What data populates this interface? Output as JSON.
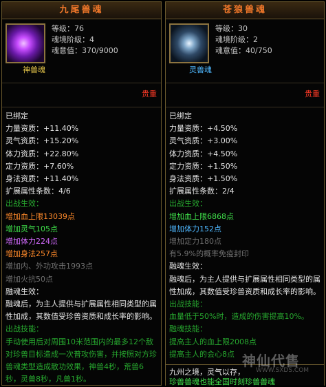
{
  "left": {
    "title": "九尾兽魂",
    "level": "等级：76",
    "soul_stage": "魂境阶级：4",
    "soul_value": "魂意值：370/9000",
    "kind": "神兽魂",
    "rarity": "贵重",
    "lines": [
      {
        "t": "已绑定",
        "c": "w"
      },
      {
        "t": "力量资质：+11.40%",
        "c": "w"
      },
      {
        "t": "灵气资质：+15.20%",
        "c": "w"
      },
      {
        "t": "体力资质：+22.80%",
        "c": "w"
      },
      {
        "t": "定力资质：+7.60%",
        "c": "w"
      },
      {
        "t": "身法资质：+11.40%",
        "c": "w"
      },
      {
        "t": "扩展属性条数：4/6",
        "c": "w"
      },
      {
        "t": "出战生效：",
        "c": "dkgreen"
      },
      {
        "t": "增加血上限13039点",
        "c": "orange"
      },
      {
        "t": "增加灵气105点",
        "c": "green"
      },
      {
        "t": "增加体力224点",
        "c": "purple"
      },
      {
        "t": "增加身法257点",
        "c": "orange"
      },
      {
        "t": "增加内、外功攻击1993点",
        "c": "gray"
      },
      {
        "t": "增加火抗50点",
        "c": "gray"
      },
      {
        "t": "融魂生效：",
        "c": "w"
      },
      {
        "t": "融魂后，为主人提供与扩展属性相同类型的属性加成，其数值受珍兽资质和成长率的影响。",
        "c": "w",
        "wrap": true
      },
      {
        "t": "出战技能：",
        "c": "dkgreen"
      },
      {
        "t": "手动使用后对周围10米范围内的最多12个敌对珍兽目标造成一次普攻伤害，并按照对方珍兽魂类型造成散功效果，神兽4秒，荒兽6秒，灵兽8秒，凡兽1秒。",
        "c": "dkgreen",
        "wrap": true
      }
    ]
  },
  "right": {
    "title": "苍狼兽魂",
    "level": "等级：30",
    "soul_stage": "魂境阶级：2",
    "soul_value": "魂意值：40/750",
    "kind": "灵兽魂",
    "rarity": "贵重",
    "lines": [
      {
        "t": "已绑定",
        "c": "w"
      },
      {
        "t": "力量资质：+4.50%",
        "c": "w"
      },
      {
        "t": "灵气资质：+3.00%",
        "c": "w"
      },
      {
        "t": "体力资质：+4.50%",
        "c": "w"
      },
      {
        "t": "定力资质：+1.50%",
        "c": "w"
      },
      {
        "t": "身法资质：+1.50%",
        "c": "w"
      },
      {
        "t": "扩展属性条数：2/4",
        "c": "w"
      },
      {
        "t": "出战生效：",
        "c": "dkgreen"
      },
      {
        "t": "增加血上限6868点",
        "c": "green"
      },
      {
        "t": "增加体力152点",
        "c": "blue"
      },
      {
        "t": "增加定力180点",
        "c": "gray"
      },
      {
        "t": "有5.9%的概率免疫封印",
        "c": "gray"
      },
      {
        "t": "融魂生效：",
        "c": "w"
      },
      {
        "t": "融魂后，为主人提供与扩展属性相同类型的属性加成，其数值受珍兽资质和成长率的影响。",
        "c": "w",
        "wrap": true
      },
      {
        "t": "出战技能：",
        "c": "dkgreen"
      },
      {
        "t": "血量低于50%时，造成的伤害提高10%。",
        "c": "dkgreen"
      },
      {
        "t": "融魂技能：",
        "c": "dkgreen"
      },
      {
        "t": "提高主人的血上限2008点",
        "c": "dkgreen"
      },
      {
        "t": "提高主人的会心8点",
        "c": "dkgreen"
      }
    ]
  },
  "lore": {
    "line1": "九州之境，灵气以存，",
    "line2": "珍兽兽魂也能全国时刻珍兽兽魂"
  },
  "watermark": {
    "name": "神仙代售",
    "url": "WWW.SXDS.COM"
  }
}
